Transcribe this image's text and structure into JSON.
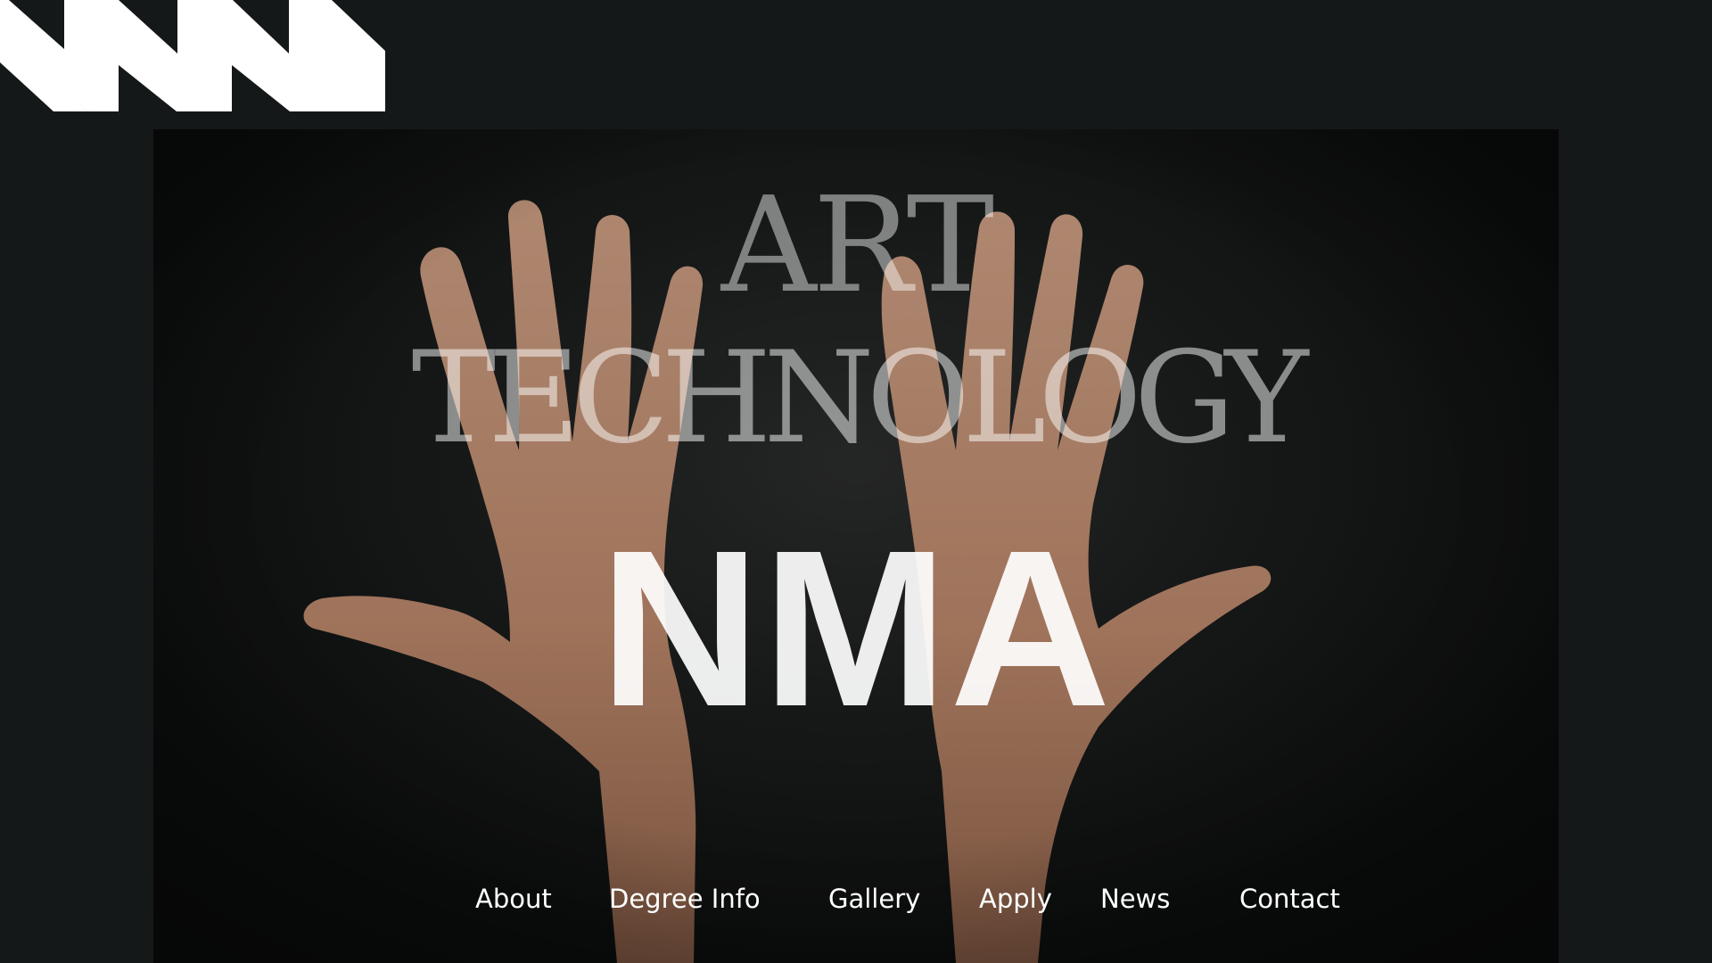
{
  "header": {
    "logo_icon": "nma-logo-icon"
  },
  "hero": {
    "title_line_1": "ART",
    "title_line_2": "TECHNOLOGY",
    "title_main": "NMA",
    "image_subject": "two open hands"
  },
  "nav": {
    "items": [
      {
        "label": "About"
      },
      {
        "label": "Degree Info"
      },
      {
        "label": "Gallery"
      },
      {
        "label": "Apply"
      },
      {
        "label": "News"
      },
      {
        "label": "Contact"
      }
    ]
  },
  "colors": {
    "background": "#151818",
    "text": "#ffffff",
    "skin": "#b98a70"
  }
}
